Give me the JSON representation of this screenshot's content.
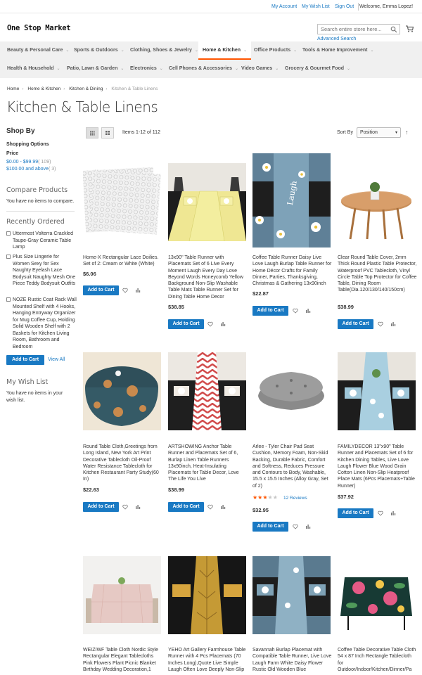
{
  "header": {
    "links": [
      "My Account",
      "My Wish List",
      "Sign Out"
    ],
    "welcome": "Welcome, Emma Lopez!",
    "logo": "One Stop Market",
    "search_placeholder": "Search entire store here...",
    "advanced_search": "Advanced Search"
  },
  "nav": {
    "row1": [
      "Beauty & Personal Care",
      "Sports & Outdoors",
      "Clothing, Shoes & Jewelry",
      "Home & Kitchen",
      "Office Products",
      "Tools & Home Improvement"
    ],
    "row2": [
      "Health & Household",
      "Patio, Lawn & Garden",
      "Electronics",
      "Cell Phones & Accessories",
      "Video Games",
      "Grocery & Gourmet Food"
    ],
    "active": "Home & Kitchen"
  },
  "breadcrumb": [
    "Home",
    "Home & Kitchen",
    "Kitchen & Dining",
    "Kitchen & Table Linens"
  ],
  "page_title": "Kitchen & Table Linens",
  "sidebar": {
    "shop_by": "Shop By",
    "shopping_options": "Shopping Options",
    "price_label": "Price",
    "price_ranges": [
      {
        "label": "$0.00 - $99.99",
        "count": "( 109)"
      },
      {
        "label": "$100.00 and above",
        "count": "( 3)"
      }
    ],
    "compare_title": "Compare Products",
    "compare_empty": "You have no items to compare.",
    "recently_title": "Recently Ordered",
    "recent_items": [
      "Uttermost Volterra Crackled Taupe-Gray Ceramic Table Lamp",
      "Plus Size Lingerie for Women Sexy for Sex Naughty Eyelash Lace Bodysuit Naughty Mesh One Piece Teddy Bodysuit Outfits",
      "NOZE Rustic Coat Rack Wall Mounted Shelf with 4 Hooks, Hanging Entryway Organizer for Mug Coffee Cup, Holding Solid Wooden Shelf with 2 Baskets for Kitchen Living Room, Bathroom and Bedroom"
    ],
    "add_to_cart": "Add to Cart",
    "view_all": "View All",
    "wishlist_title": "My Wish List",
    "wishlist_empty": "You have no items in your wish list."
  },
  "toolbar": {
    "count": "Items 1-12 of 112",
    "sort_by": "Sort By",
    "sort_value": "Position",
    "sort_dir": "↑"
  },
  "add_to_cart": "Add to Cart",
  "products": [
    {
      "name": "Home-X Rectangular Lace Doilies. Set of 2: Cream or White (White)",
      "price": "$6.06"
    },
    {
      "name": "13x90\" Table Runner with Placemats Set of 6 Live Every Moment Laugh Every Day Love Beyond Words Honeycomb Yellow Background Non-Slip Washable Table Mats Table Runner Set for Dining Table Home Decor",
      "price": "$38.85"
    },
    {
      "name": "Coffee Table Runner Daisy Live Love Laugh Burlap Table Runner for Home Décor Crafts for Family Dinner, Parties, Thanksgiving, Christmas & Gathering 13x90inch",
      "price": "$22.87"
    },
    {
      "name": "Clear Round Table Cover, 2mm Thick Round Plastic Table Protector, Waterproof PVC Tablecloth, Vinyl Circle Table Top Protector for Coffee Table, Dining Room Table(Dia.120/130/140/150cm)",
      "price": "$38.99"
    },
    {
      "name": "Round Table Cloth,Greetings from Long Island, New York Art Print Decorative Tablecloth Oil-Proof Water Resistance Tablecloth for Kitchen Restaurant Party Study(60 In)",
      "price": "$22.63"
    },
    {
      "name": "ARTSHOWING Anchor Table Runner and Placemats Set of 6, Burlap Linen Table Runners 13x90inch, Heat-Insulating Placemats for Table Decor, Love The Life You Live",
      "price": "$38.99"
    },
    {
      "name": "Arlee - Tyler Chair Pad Seat Cushion, Memory Foam, Non-Skid Backing, Durable Fabric, Comfort and Softness, Reduces Pressure and Contours to Body, Washable, 15.5 x 15.5 Inches (Alloy Gray, Set of 2)",
      "price": "$32.95",
      "rating": 3,
      "reviews": "12  Reviews"
    },
    {
      "name": "FAMILYDECOR 13\"x90\" Table Runner and Placemats Set of 6 for Kitchen Dining Tables, Live Love Laugh Flower Blue Wood Grain Cotton Linen Non-Slip Heatproof Place Mats (6Pcs Placemats+Table Runner)",
      "price": "$37.92"
    },
    {
      "name": "WEIZIWF Table Cloth Nordic Style Rectangular Elegant Tablecloths Pink Flowers Plant Picnic Blanket Birthday Wedding Decoration,1"
    },
    {
      "name": "YEHO Art Gallery Farmhouse Table Runner with 4 Pcs Placemats (70 Inches Long),Quote Live Simple Laugh Often Love Deeply Non-Slip"
    },
    {
      "name": "Savannah Burlap Placemat with Compatible Table Runner, Live Love Laugh Farm White Daisy Flower Rustic Old Wooden Blue"
    },
    {
      "name": "Coffee Table Decorative Table Cloth 54 x 87 Inch Rectangle Tablecloth for Outdoor/Indoor/Kitchen/Dinner/Pa"
    }
  ]
}
